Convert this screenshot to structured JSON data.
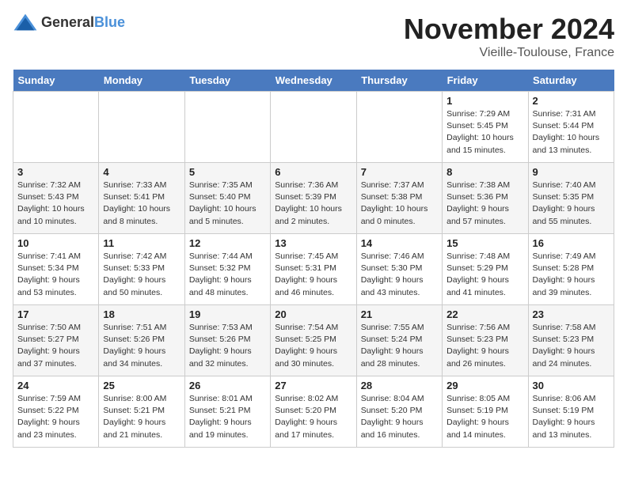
{
  "header": {
    "logo_general": "General",
    "logo_blue": "Blue",
    "month": "November 2024",
    "location": "Vieille-Toulouse, France"
  },
  "days_of_week": [
    "Sunday",
    "Monday",
    "Tuesday",
    "Wednesday",
    "Thursday",
    "Friday",
    "Saturday"
  ],
  "weeks": [
    [
      {
        "day": "",
        "info": ""
      },
      {
        "day": "",
        "info": ""
      },
      {
        "day": "",
        "info": ""
      },
      {
        "day": "",
        "info": ""
      },
      {
        "day": "",
        "info": ""
      },
      {
        "day": "1",
        "info": "Sunrise: 7:29 AM\nSunset: 5:45 PM\nDaylight: 10 hours and 15 minutes."
      },
      {
        "day": "2",
        "info": "Sunrise: 7:31 AM\nSunset: 5:44 PM\nDaylight: 10 hours and 13 minutes."
      }
    ],
    [
      {
        "day": "3",
        "info": "Sunrise: 7:32 AM\nSunset: 5:43 PM\nDaylight: 10 hours and 10 minutes."
      },
      {
        "day": "4",
        "info": "Sunrise: 7:33 AM\nSunset: 5:41 PM\nDaylight: 10 hours and 8 minutes."
      },
      {
        "day": "5",
        "info": "Sunrise: 7:35 AM\nSunset: 5:40 PM\nDaylight: 10 hours and 5 minutes."
      },
      {
        "day": "6",
        "info": "Sunrise: 7:36 AM\nSunset: 5:39 PM\nDaylight: 10 hours and 2 minutes."
      },
      {
        "day": "7",
        "info": "Sunrise: 7:37 AM\nSunset: 5:38 PM\nDaylight: 10 hours and 0 minutes."
      },
      {
        "day": "8",
        "info": "Sunrise: 7:38 AM\nSunset: 5:36 PM\nDaylight: 9 hours and 57 minutes."
      },
      {
        "day": "9",
        "info": "Sunrise: 7:40 AM\nSunset: 5:35 PM\nDaylight: 9 hours and 55 minutes."
      }
    ],
    [
      {
        "day": "10",
        "info": "Sunrise: 7:41 AM\nSunset: 5:34 PM\nDaylight: 9 hours and 53 minutes."
      },
      {
        "day": "11",
        "info": "Sunrise: 7:42 AM\nSunset: 5:33 PM\nDaylight: 9 hours and 50 minutes."
      },
      {
        "day": "12",
        "info": "Sunrise: 7:44 AM\nSunset: 5:32 PM\nDaylight: 9 hours and 48 minutes."
      },
      {
        "day": "13",
        "info": "Sunrise: 7:45 AM\nSunset: 5:31 PM\nDaylight: 9 hours and 46 minutes."
      },
      {
        "day": "14",
        "info": "Sunrise: 7:46 AM\nSunset: 5:30 PM\nDaylight: 9 hours and 43 minutes."
      },
      {
        "day": "15",
        "info": "Sunrise: 7:48 AM\nSunset: 5:29 PM\nDaylight: 9 hours and 41 minutes."
      },
      {
        "day": "16",
        "info": "Sunrise: 7:49 AM\nSunset: 5:28 PM\nDaylight: 9 hours and 39 minutes."
      }
    ],
    [
      {
        "day": "17",
        "info": "Sunrise: 7:50 AM\nSunset: 5:27 PM\nDaylight: 9 hours and 37 minutes."
      },
      {
        "day": "18",
        "info": "Sunrise: 7:51 AM\nSunset: 5:26 PM\nDaylight: 9 hours and 34 minutes."
      },
      {
        "day": "19",
        "info": "Sunrise: 7:53 AM\nSunset: 5:26 PM\nDaylight: 9 hours and 32 minutes."
      },
      {
        "day": "20",
        "info": "Sunrise: 7:54 AM\nSunset: 5:25 PM\nDaylight: 9 hours and 30 minutes."
      },
      {
        "day": "21",
        "info": "Sunrise: 7:55 AM\nSunset: 5:24 PM\nDaylight: 9 hours and 28 minutes."
      },
      {
        "day": "22",
        "info": "Sunrise: 7:56 AM\nSunset: 5:23 PM\nDaylight: 9 hours and 26 minutes."
      },
      {
        "day": "23",
        "info": "Sunrise: 7:58 AM\nSunset: 5:23 PM\nDaylight: 9 hours and 24 minutes."
      }
    ],
    [
      {
        "day": "24",
        "info": "Sunrise: 7:59 AM\nSunset: 5:22 PM\nDaylight: 9 hours and 23 minutes."
      },
      {
        "day": "25",
        "info": "Sunrise: 8:00 AM\nSunset: 5:21 PM\nDaylight: 9 hours and 21 minutes."
      },
      {
        "day": "26",
        "info": "Sunrise: 8:01 AM\nSunset: 5:21 PM\nDaylight: 9 hours and 19 minutes."
      },
      {
        "day": "27",
        "info": "Sunrise: 8:02 AM\nSunset: 5:20 PM\nDaylight: 9 hours and 17 minutes."
      },
      {
        "day": "28",
        "info": "Sunrise: 8:04 AM\nSunset: 5:20 PM\nDaylight: 9 hours and 16 minutes."
      },
      {
        "day": "29",
        "info": "Sunrise: 8:05 AM\nSunset: 5:19 PM\nDaylight: 9 hours and 14 minutes."
      },
      {
        "day": "30",
        "info": "Sunrise: 8:06 AM\nSunset: 5:19 PM\nDaylight: 9 hours and 13 minutes."
      }
    ]
  ]
}
